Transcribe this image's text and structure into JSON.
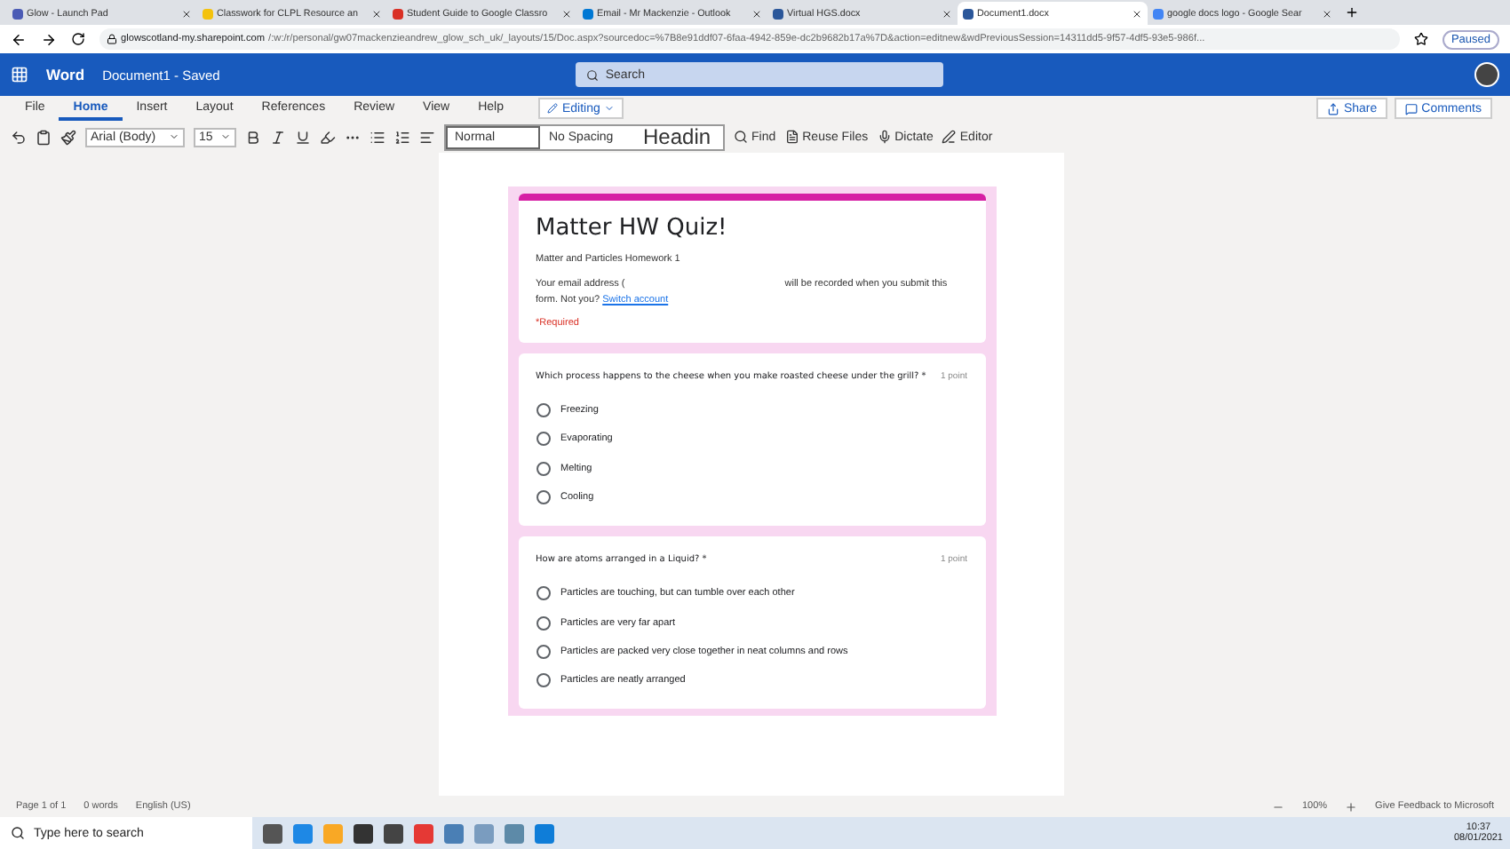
{
  "browser_tabs": [
    {
      "title": "Glow - Launch Pad",
      "selected": false
    },
    {
      "title": "Classwork for CLPL Resource an",
      "selected": false
    },
    {
      "title": "Student Guide to Google Classro",
      "selected": false
    },
    {
      "title": "Email - Mr Mackenzie - Outlook",
      "selected": false
    },
    {
      "title": "Virtual HGS.docx",
      "selected": false
    },
    {
      "title": "Document1.docx",
      "selected": true
    },
    {
      "title": "google docs logo - Google Sear",
      "selected": false
    }
  ],
  "address": {
    "host": "glowscotland-my.sharepoint.com",
    "path": "/:w:/r/personal/gw07mackenzieandrew_glow_sch_uk/_layouts/15/Doc.aspx?sourcedoc=%7B8e91ddf07-6faa-4942-859e-dc2b9682b17a%7D&action=editnew&wdPreviousSession=14311dd5-9f57-4df5-93e5-986f...",
    "profile_status": "Paused"
  },
  "app": {
    "name": "Word",
    "document": "Document1 - Saved",
    "search_placeholder": "Search"
  },
  "ribbon_tabs": [
    {
      "label": "File",
      "selected": false
    },
    {
      "label": "Home",
      "selected": true
    },
    {
      "label": "Insert",
      "selected": false
    },
    {
      "label": "Layout",
      "selected": false
    },
    {
      "label": "References",
      "selected": false
    },
    {
      "label": "Review",
      "selected": false
    },
    {
      "label": "View",
      "selected": false
    },
    {
      "label": "Help",
      "selected": false
    }
  ],
  "mode": "Editing",
  "share": "Share",
  "comments": "Comments",
  "toolbar": {
    "font": "Arial (Body)",
    "size": "15",
    "styles": [
      {
        "label": "Normal",
        "selected": true
      },
      {
        "label": "No Spacing",
        "selected": false
      },
      {
        "label": "Headin",
        "selected": false
      }
    ],
    "find": "Find",
    "reuse": "Reuse Files",
    "dictate": "Dictate",
    "editor": "Editor"
  },
  "form": {
    "title": "Matter HW Quiz!",
    "subtitle": "Matter and Particles Homework 1",
    "email_before": "Your email address (",
    "email_after": "will be recorded when you submit this form. Not you?",
    "switch_link": "Switch account",
    "required": "*Required",
    "questions": [
      {
        "text": "Which process happens to the cheese when you make roasted cheese under the grill? *",
        "points": "1 point",
        "options": [
          {
            "label": "Freezing",
            "selected": false
          },
          {
            "label": "Evaporating",
            "selected": false
          },
          {
            "label": "Melting",
            "selected": false
          },
          {
            "label": "Cooling",
            "selected": false
          }
        ]
      },
      {
        "text": "How are atoms arranged in a Liquid? *",
        "points": "1 point",
        "options": [
          {
            "label": "Particles are touching, but can tumble over each other",
            "selected": false
          },
          {
            "label": "Particles are very far apart",
            "selected": false
          },
          {
            "label": "Particles are packed very close together in neat columns and rows",
            "selected": false
          },
          {
            "label": "Particles are neatly arranged",
            "selected": false
          }
        ]
      }
    ]
  },
  "status": {
    "page": "Page 1 of 1",
    "words": "0 words",
    "language": "English (US)",
    "zoom": "100%",
    "feedback": "Give Feedback to Microsoft"
  },
  "taskbar": {
    "search_placeholder": "Type here to search",
    "time": "10:37",
    "date": "08/01/2021"
  }
}
